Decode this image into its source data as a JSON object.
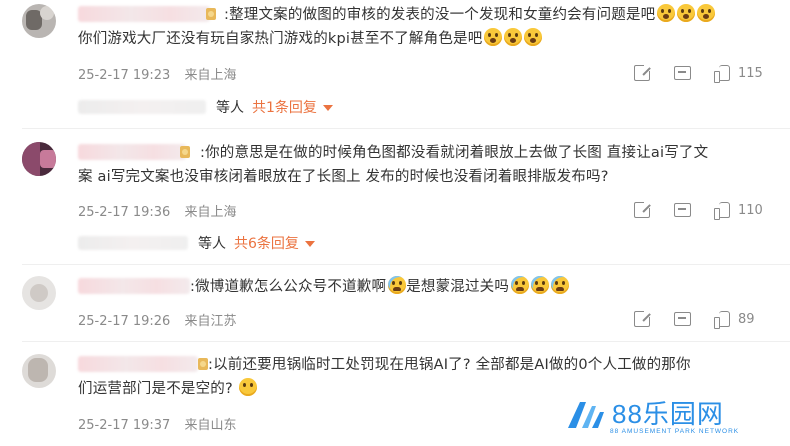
{
  "comments": [
    {
      "text_lines": [
        ":整理文案的做图的审核的发表的没一个发现和女童约会有问题是吧",
        "你们游戏大厂还没有玩自家热门游戏的kpi甚至不了解角色是吧"
      ],
      "emoji_line1": [
        "shock",
        "shock",
        "shock"
      ],
      "emoji_line2": [
        "shock",
        "shock",
        "shock"
      ],
      "date": "25-2-17 19:23",
      "location": "来自上海",
      "likes": "115",
      "reply": {
        "people": "等人",
        "link": "共1条回复"
      }
    },
    {
      "text_lines": [
        ":你的意思是在做的时候角色图都没看就闭着眼放上去做了长图 直接让ai写了文",
        "案 ai写完文案也没审核闭着眼放在了长图上 发布的时候也没看闭着眼排版发布吗?"
      ],
      "date": "25-2-17 19:36",
      "location": "来自上海",
      "likes": "110",
      "reply": {
        "people": "等人",
        "link": "共6条回复"
      }
    },
    {
      "text_lines": [
        ":微博道歉怎么公众号不道歉啊",
        "是想蒙混过关吗"
      ],
      "emoji_mid": [
        "cry"
      ],
      "emoji_end": [
        "cry",
        "cry",
        "cry"
      ],
      "date": "25-2-17 19:26",
      "location": "来自江苏",
      "likes": "89"
    },
    {
      "text_lines": [
        ":以前还要甩锅临时工处罚现在甩锅AI了? 全部都是AI做的0个人工做的那你",
        "们运营部门是不是空的?"
      ],
      "emoji_end": [
        "sweat"
      ],
      "date": "25-2-17 19:37",
      "location": "来自山东"
    }
  ],
  "watermark": {
    "brand": "88乐园网",
    "tagline": "88 AMUSEMENT PARK NETWORK"
  },
  "colors": {
    "accent": "#eb7340",
    "watermark": "#2b8fe6",
    "meta": "#8a8a8a"
  },
  "icons": [
    "share-icon",
    "comment-icon",
    "like-icon",
    "caret-down-icon"
  ]
}
